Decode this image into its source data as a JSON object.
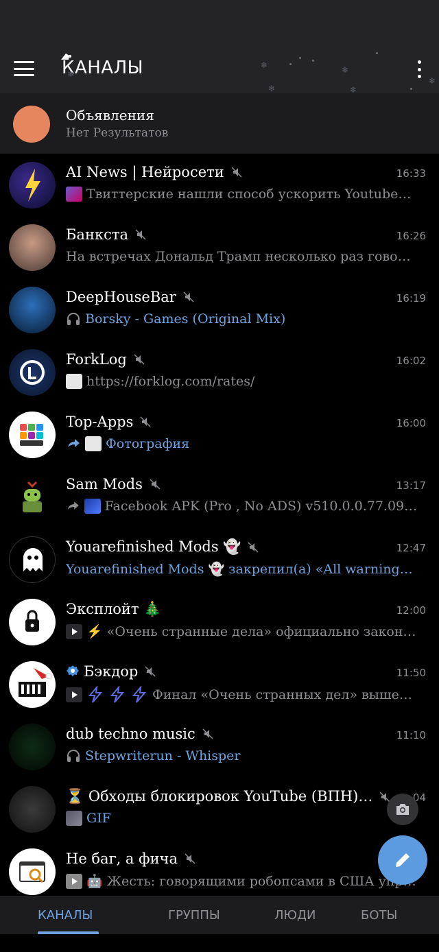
{
  "header": {
    "title": "КАНАЛЫ"
  },
  "announcement": {
    "title": "Объявления",
    "subtitle": "Нет Результатов",
    "avatar_color": "#e5865f"
  },
  "chats": [
    {
      "name": "AI News | Нейросети",
      "time": "16:33",
      "preview": "Твиттерские нашли способ ускорить Youtube…"
    },
    {
      "name": "Банкста",
      "time": "16:26",
      "preview": "На встречах Дональд Трамп несколько раз гово…"
    },
    {
      "name": "DeepHouseBar",
      "time": "16:19",
      "preview": "Borsky - Games (Original Mix)"
    },
    {
      "name": "ForkLog",
      "time": "16:02",
      "preview": "https://forklog.com/rates/"
    },
    {
      "name": "Top-Apps",
      "time": "16:00",
      "preview": "Фотография"
    },
    {
      "name": "Sam Mods",
      "time": "13:17",
      "preview": "Facebook APK (Pro , No ADS) v510.0.0.77.09 Do…"
    },
    {
      "name": "Youarefinished Mods 👻",
      "time": "12:47",
      "preview": "Youarefinished Mods 👻 закрепил(а) «All warnings…"
    },
    {
      "name": "Эксплойт 🎄",
      "time": "12:00",
      "preview": "⚡ «Очень странные дела» официально закон…"
    },
    {
      "name": "Бэкдор",
      "time": "11:50",
      "preview": "Финал «Очень странных дел» выше…"
    },
    {
      "name": "dub techno music",
      "time": "11:10",
      "preview": "Stepwriterun - Whisper"
    },
    {
      "name": "⏳ Обходы блокировок YouTube (ВПН)…",
      "time": "04",
      "preview": "GIF"
    },
    {
      "name": "Не баг, а фича",
      "time": "",
      "preview": "🤖 Жесть: говорящими робопсами в США упр…"
    }
  ],
  "tabs": [
    {
      "label": "КАНАЛЫ",
      "active": true
    },
    {
      "label": "ГРУППЫ",
      "active": false
    },
    {
      "label": "ЛЮДИ",
      "active": false
    },
    {
      "label": "БОТЫ",
      "active": false
    }
  ],
  "colors": {
    "accent": "#6ea3e0",
    "fab": "#5d9be0",
    "header_bg": "#242427",
    "muted": "#8e8e93"
  }
}
